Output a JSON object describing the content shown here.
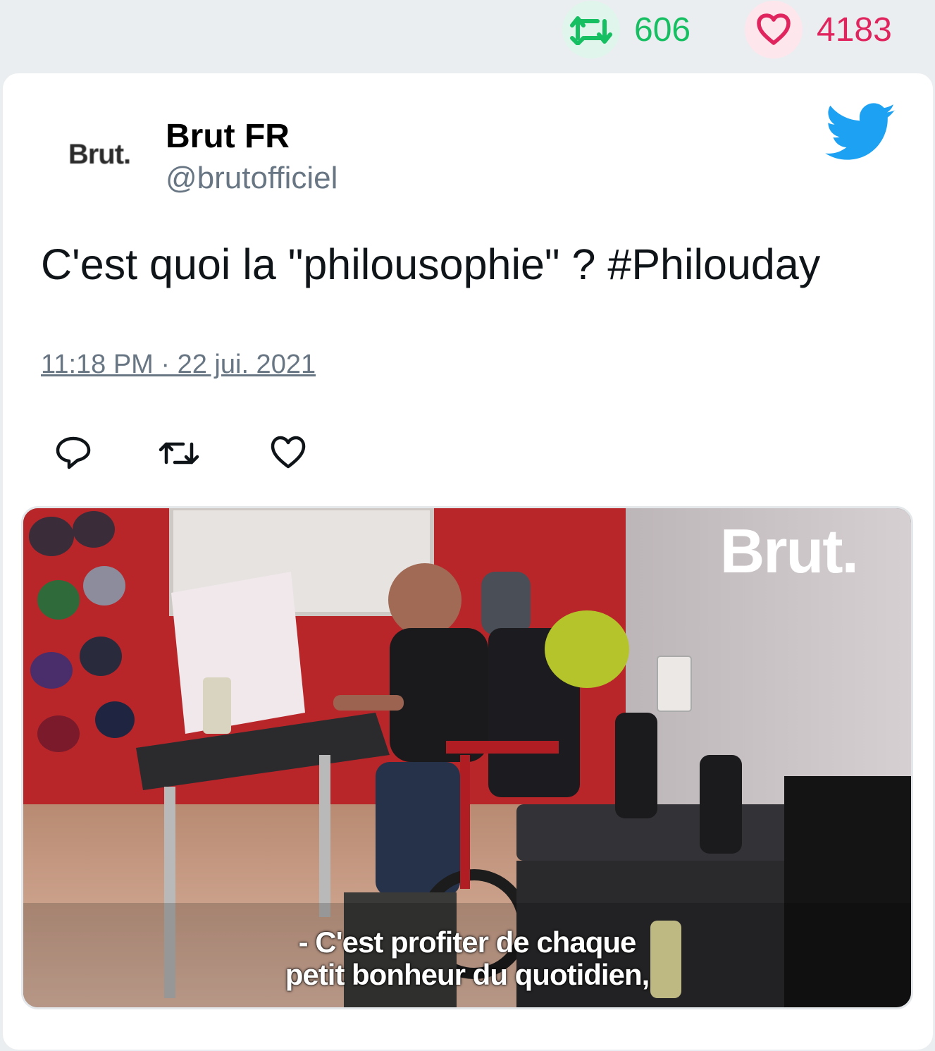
{
  "stats": {
    "retweet_count": "606",
    "like_count": "4183",
    "retweet_color": "#17bf63",
    "like_color": "#e0245e"
  },
  "author": {
    "avatar_logo": "Brut.",
    "name": "Brut FR",
    "handle": "@brutofficiel",
    "platform_icon": "twitter-bird-icon"
  },
  "tweet": {
    "text": "C'est quoi la \"philousophie\" ? #Philouday",
    "timestamp": "11:18 PM · 22 jui. 2021"
  },
  "actions": {
    "reply_icon": "reply-icon",
    "retweet_icon": "retweet-icon",
    "like_icon": "heart-icon"
  },
  "media": {
    "watermark": "Brut.",
    "subtitle_line1": "- C'est profiter de chaque",
    "subtitle_line2": "petit bonheur du quotidien,"
  }
}
